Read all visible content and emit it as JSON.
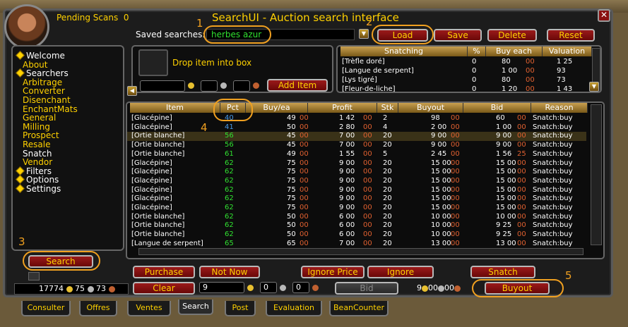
{
  "header": {
    "pending_label": "Pending Scans",
    "pending_count": "0",
    "title": "SearchUI - Auction search interface",
    "close": "✕"
  },
  "saved": {
    "label": "Saved searches:",
    "value": "herbes azur"
  },
  "toolbar": {
    "load": "Load",
    "save": "Save",
    "delete": "Delete",
    "reset": "Reset"
  },
  "annotations": [
    "1",
    "2",
    "3",
    "4",
    "5"
  ],
  "sidebar": {
    "items": [
      {
        "label": "Welcome",
        "level": 0,
        "bullet": true
      },
      {
        "label": "About",
        "level": 1
      },
      {
        "label": "Searchers",
        "level": 0,
        "bullet": true
      },
      {
        "label": "Arbitrage",
        "level": 1
      },
      {
        "label": "Converter",
        "level": 1
      },
      {
        "label": "Disenchant",
        "level": 1
      },
      {
        "label": "EnchantMats",
        "level": 1
      },
      {
        "label": "General",
        "level": 1
      },
      {
        "label": "Milling",
        "level": 1
      },
      {
        "label": "Prospect",
        "level": 1
      },
      {
        "label": "Resale",
        "level": 1
      },
      {
        "label": "Snatch",
        "level": 1,
        "selected": true
      },
      {
        "label": "Vendor",
        "level": 1
      },
      {
        "label": "Filters",
        "level": 0,
        "bullet": true
      },
      {
        "label": "Options",
        "level": 0,
        "bullet": true
      },
      {
        "label": "Settings",
        "level": 0,
        "bullet": true
      }
    ]
  },
  "dropbox": {
    "label": "Drop item into box",
    "add_item": "Add Item"
  },
  "snatch_table": {
    "headers": [
      "Snatching",
      "%",
      "Buy each",
      "Valuation"
    ],
    "rows": [
      {
        "item": "[Trèfle doré]",
        "pct": "0",
        "gold": "80",
        "copper": "00",
        "val": "1 25"
      },
      {
        "item": "[Langue de serpent]",
        "pct": "0",
        "gold": "1 00",
        "copper": "00",
        "val": "93"
      },
      {
        "item": "[Lys tigré]",
        "pct": "0",
        "gold": "80",
        "copper": "00",
        "val": "73"
      },
      {
        "item": "[Fleur-de-liche]",
        "pct": "0",
        "gold": "1 20",
        "copper": "00",
        "val": "1 43"
      }
    ]
  },
  "results": {
    "headers": [
      "Item",
      "Pct",
      "Buy/ea",
      "Profit",
      "Stk",
      "Buyout",
      "Bid",
      "Reason"
    ],
    "rows": [
      {
        "item": "[Glacépine]",
        "pct": "40",
        "buy": "49",
        "buyc": "00",
        "profit": "1 42",
        "profitc": "00",
        "stk": "2",
        "buyout": "98",
        "buyoutc": "00",
        "bid": "60",
        "bidc": "00",
        "reason": "Snatch:buy"
      },
      {
        "item": "[Glacépine]",
        "pct": "41",
        "buy": "50",
        "buyc": "00",
        "profit": "2 80",
        "profitc": "00",
        "stk": "4",
        "buyout": "2 00",
        "buyoutc": "00",
        "bid": "1 00",
        "bidc": "00",
        "reason": "Snatch:buy"
      },
      {
        "item": "[Ortie blanche]",
        "pct": "56",
        "buy": "45",
        "buyc": "00",
        "profit": "7 00",
        "profitc": "00",
        "stk": "20",
        "buyout": "9 00",
        "buyoutc": "00",
        "bid": "9 00",
        "bidc": "00",
        "reason": "Snatch:buy"
      },
      {
        "item": "[Ortie blanche]",
        "pct": "56",
        "buy": "45",
        "buyc": "00",
        "profit": "7 00",
        "profitc": "00",
        "stk": "20",
        "buyout": "9 00",
        "buyoutc": "00",
        "bid": "9 00",
        "bidc": "00",
        "reason": "Snatch:buy"
      },
      {
        "item": "[Ortie blanche]",
        "pct": "61",
        "buy": "49",
        "buyc": "00",
        "profit": "1 55",
        "profitc": "00",
        "stk": "5",
        "buyout": "2 45",
        "buyoutc": "00",
        "bid": "1 56",
        "bidc": "25",
        "reason": "Snatch:buy"
      },
      {
        "item": "[Glacépine]",
        "pct": "62",
        "buy": "75",
        "buyc": "00",
        "profit": "9 00",
        "profitc": "00",
        "stk": "20",
        "buyout": "15 00",
        "buyoutc": "00",
        "bid": "15 00",
        "bidc": "00",
        "reason": "Snatch:buy"
      },
      {
        "item": "[Glacépine]",
        "pct": "62",
        "buy": "75",
        "buyc": "00",
        "profit": "9 00",
        "profitc": "00",
        "stk": "20",
        "buyout": "15 00",
        "buyoutc": "00",
        "bid": "15 00",
        "bidc": "00",
        "reason": "Snatch:buy"
      },
      {
        "item": "[Glacépine]",
        "pct": "62",
        "buy": "75",
        "buyc": "00",
        "profit": "9 00",
        "profitc": "00",
        "stk": "20",
        "buyout": "15 00",
        "buyoutc": "00",
        "bid": "15 00",
        "bidc": "00",
        "reason": "Snatch:buy"
      },
      {
        "item": "[Glacépine]",
        "pct": "62",
        "buy": "75",
        "buyc": "00",
        "profit": "9 00",
        "profitc": "00",
        "stk": "20",
        "buyout": "15 00",
        "buyoutc": "00",
        "bid": "15 00",
        "bidc": "00",
        "reason": "Snatch:buy"
      },
      {
        "item": "[Glacépine]",
        "pct": "62",
        "buy": "75",
        "buyc": "00",
        "profit": "9 00",
        "profitc": "00",
        "stk": "20",
        "buyout": "15 00",
        "buyoutc": "00",
        "bid": "15 00",
        "bidc": "00",
        "reason": "Snatch:buy"
      },
      {
        "item": "[Glacépine]",
        "pct": "62",
        "buy": "75",
        "buyc": "00",
        "profit": "9 00",
        "profitc": "00",
        "stk": "20",
        "buyout": "15 00",
        "buyoutc": "00",
        "bid": "15 00",
        "bidc": "00",
        "reason": "Snatch:buy"
      },
      {
        "item": "[Ortie blanche]",
        "pct": "62",
        "buy": "50",
        "buyc": "00",
        "profit": "6 00",
        "profitc": "00",
        "stk": "20",
        "buyout": "10 00",
        "buyoutc": "00",
        "bid": "10 00",
        "bidc": "00",
        "reason": "Snatch:buy"
      },
      {
        "item": "[Ortie blanche]",
        "pct": "62",
        "buy": "50",
        "buyc": "00",
        "profit": "6 00",
        "profitc": "00",
        "stk": "20",
        "buyout": "10 00",
        "buyoutc": "00",
        "bid": "9 25",
        "bidc": "00",
        "reason": "Snatch:buy"
      },
      {
        "item": "[Ortie blanche]",
        "pct": "62",
        "buy": "50",
        "buyc": "00",
        "profit": "6 00",
        "profitc": "00",
        "stk": "20",
        "buyout": "10 00",
        "buyoutc": "00",
        "bid": "9 25",
        "bidc": "00",
        "reason": "Snatch:buy"
      },
      {
        "item": "[Langue de serpent]",
        "pct": "65",
        "buy": "65",
        "buyc": "00",
        "profit": "7 00",
        "profitc": "00",
        "stk": "20",
        "buyout": "13 00",
        "buyoutc": "00",
        "bid": "13 00",
        "bidc": "00",
        "reason": "Snatch:buy"
      }
    ]
  },
  "bottom": {
    "search": "Search",
    "purchase": "Purchase",
    "not_now": "Not Now",
    "ignore_price": "Ignore Price",
    "ignore": "Ignore",
    "snatch": "Snatch",
    "clear": "Clear",
    "bid": "Bid",
    "buyout": "Buyout",
    "qty": "9",
    "silver_in": "0",
    "copper_in": "0",
    "price_gold": "9",
    "price_silver": "00",
    "price_copper": "00"
  },
  "money": {
    "gold": "17774",
    "silver": "75",
    "copper": "73"
  },
  "tabs": [
    "Consulter",
    "Offres",
    "Ventes",
    "Search",
    "Post",
    "Evaluation",
    "BeanCounter"
  ],
  "colors": {
    "accent_gold": "#ffd100",
    "button_red": "#9a1a1a",
    "annotation": "#f0a020",
    "pct_blue": "#4a9ae8",
    "pct_green": "#30e030"
  }
}
